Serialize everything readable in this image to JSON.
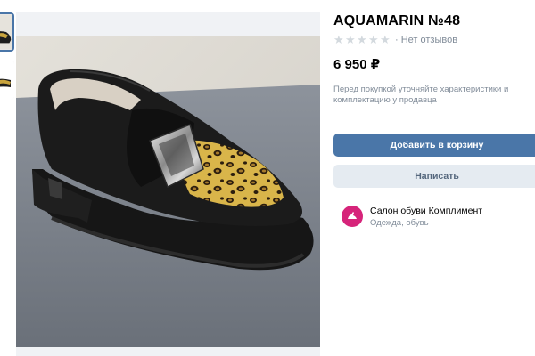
{
  "product": {
    "title": "AQUAMARIN №48",
    "rating": {
      "value": 0,
      "max": 5,
      "reviews_label": "· Нет отзывов"
    },
    "price": "6 950 ₽",
    "note": "Перед покупкой уточняйте характеристики и комплектацию у продавца"
  },
  "actions": {
    "add_to_cart": "Добавить в корзину",
    "write": "Написать"
  },
  "seller": {
    "name": "Салон обуви Комплимент",
    "category": "Одежда, обувь",
    "avatar_color": "#d6247a"
  },
  "gallery": {
    "thumbnail_count": 2,
    "selected_index": 0,
    "image_subject": "black suede loafer with leopard print insert and silver buckle"
  },
  "colors": {
    "accent": "#4a76a8",
    "secondary_button": "#e5ebf1",
    "muted_text": "#818c99"
  }
}
